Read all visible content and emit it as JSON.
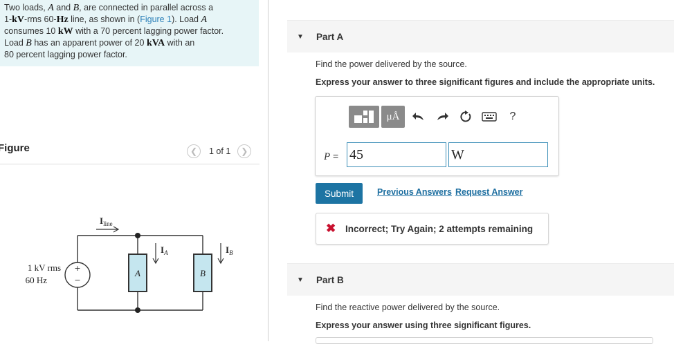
{
  "problem": {
    "t1": "Two loads, ",
    "loadA": "A",
    "t2": " and ",
    "loadB": "B",
    "t3": ", are connected in parallel across a",
    "t4": "1-",
    "kv": "kV",
    "t5": "-rms 60-",
    "hz": "Hz",
    "t6": " line, as shown in (",
    "figure_link": "Figure 1",
    "t7": "). Load ",
    "t8": "consumes 10 ",
    "kw": "kW",
    "t9": " with a 70 percent lagging power factor.",
    "t10": "Load ",
    "t11": " has an apparent power of 20 ",
    "kva": "kVA",
    "t12": " with an",
    "t13": "80 percent lagging power factor."
  },
  "figure": {
    "title": "Figure",
    "count": "1 of 1",
    "prev_icon": "chevron-left-icon",
    "next_icon": "chevron-right-icon",
    "circuit": {
      "source_label_1": "1 kV rms",
      "source_label_2": "60 Hz",
      "i_line": "I",
      "i_line_sub": "line",
      "i_a": "I",
      "i_a_sub": "A",
      "i_b": "I",
      "i_b_sub": "B",
      "load_a": "A",
      "load_b": "B",
      "plus": "+",
      "minus": "−"
    }
  },
  "partA": {
    "label": "Part A",
    "question": "Find the power delivered by the source.",
    "instruction": "Express your answer to three significant figures and include the appropriate units.",
    "toolbar": {
      "templates_icon": "templates-icon",
      "units_label": "μÅ",
      "undo_icon": "undo-icon",
      "redo_icon": "redo-icon",
      "reset_icon": "reset-icon",
      "keyboard_icon": "keyboard-icon",
      "help_label": "?"
    },
    "var_label": "P",
    "equals": " =",
    "value": "45",
    "unit": "W",
    "submit": "Submit",
    "previous_answers": "Previous Answers",
    "request_answer": "Request Answer",
    "feedback": "Incorrect; Try Again; 2 attempts remaining",
    "feedback_icon": "x-icon"
  },
  "partB": {
    "label": "Part B",
    "question": "Find the reactive power delivered by the source.",
    "instruction": "Express your answer using three significant figures."
  },
  "colors": {
    "problem_bg": "#e7f5f7",
    "accent": "#1d74a3",
    "input_border": "#3b8eb7",
    "error": "#c8102e",
    "load_fill": "#c5e6ef"
  }
}
